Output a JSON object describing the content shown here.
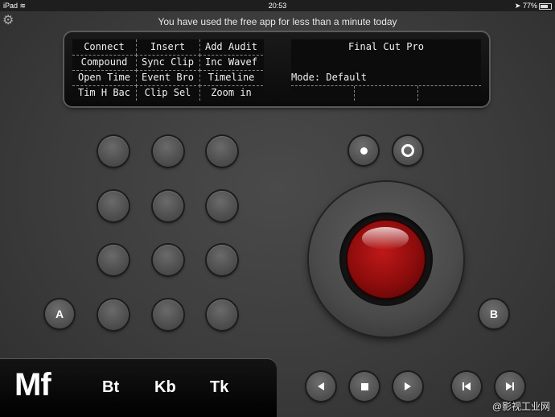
{
  "status_bar": {
    "device": "iPad",
    "time": "20:53",
    "battery": "77%",
    "battery_level": 0.77
  },
  "notice": "You have used the free app for less than a minute today",
  "lcd": {
    "grid": [
      [
        "Connect",
        "Insert",
        "Add Audit"
      ],
      [
        "Compound",
        "Sync Clip",
        "Inc Wavef"
      ],
      [
        "Open Time",
        "Event Bro",
        "Timeline"
      ],
      [
        "Tim H Bac",
        "Clip Sel",
        "Zoom in"
      ]
    ],
    "app_name": "Final Cut Pro",
    "mode": "Mode: Default"
  },
  "buttons": {
    "a_label": "A",
    "b_label": "B"
  },
  "mode_bar": {
    "items": [
      "Mf",
      "Bt",
      "Kb",
      "Tk"
    ],
    "selected": "Mf"
  },
  "watermark": "@影视工业网"
}
